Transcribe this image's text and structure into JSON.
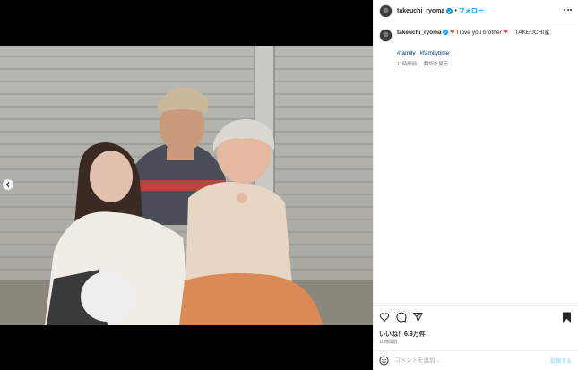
{
  "post": {
    "username": "takeuchi_ryoma",
    "follow_label": "フォロー",
    "separator": "•",
    "caption_text": "I love you brother",
    "caption_suffix": "TAKEUCHI家",
    "hashtags": [
      "#family",
      "#familytime"
    ],
    "caption_time": "11時間前",
    "translate_label": "翻訳を見る",
    "likes_label": "いいね！6.9万件",
    "posted_time": "11時間前",
    "comment_placeholder": "コメントを追加...",
    "post_button": "投稿する"
  },
  "icons": {
    "verified": "verified-badge-icon",
    "like": "heart-outline-icon",
    "comment": "comment-bubble-icon",
    "share": "paper-plane-icon",
    "save": "bookmark-icon",
    "emoji": "smiley-icon",
    "more": "more-dots-icon",
    "carousel": "chevron-left-icon"
  },
  "colors": {
    "accent": "#0095f6",
    "heart": "#ed4956",
    "hashtag": "#00376b",
    "verified": "#0095f6"
  }
}
